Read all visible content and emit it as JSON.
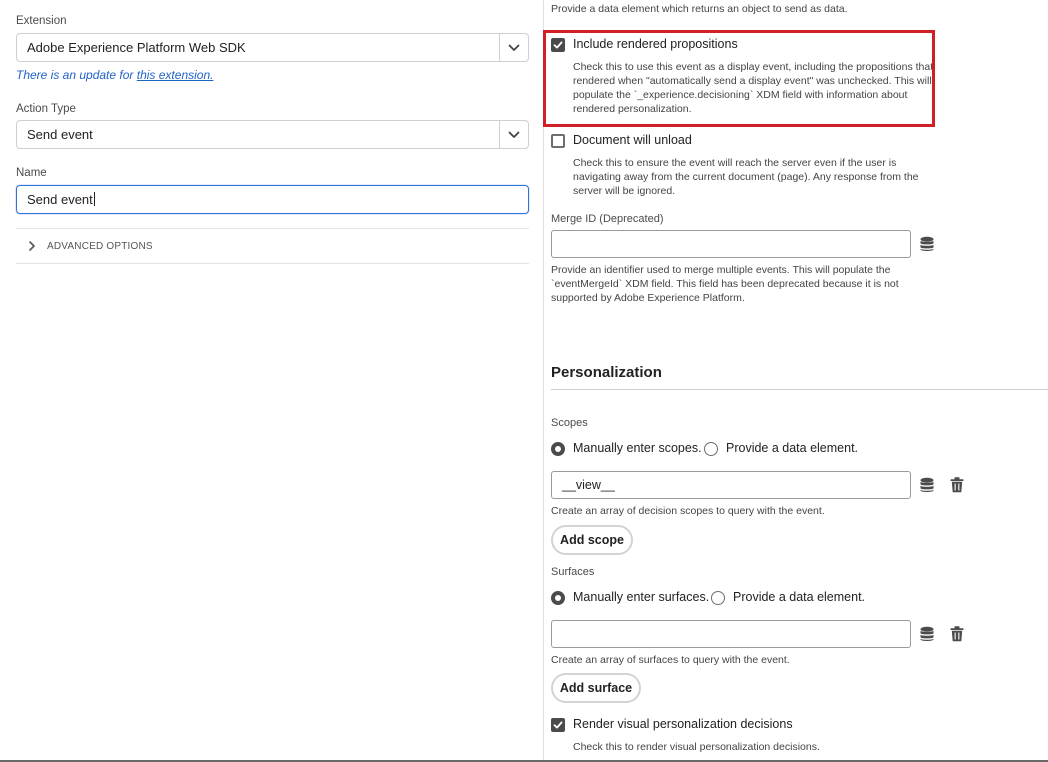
{
  "left": {
    "extension_label": "Extension",
    "extension_value": "Adobe Experience Platform Web SDK",
    "update_prefix": "There is an update for ",
    "update_link": "this extension.",
    "action_type_label": "Action Type",
    "action_type_value": "Send event",
    "name_label": "Name",
    "name_value": "Send event",
    "advanced_options": "ADVANCED OPTIONS"
  },
  "right": {
    "top_help": "Provide a data element which returns an object to send as data.",
    "include_props": {
      "label": "Include rendered propositions",
      "checked": true,
      "help": [
        "Check this to use this event as a display event, including the propositions that",
        "rendered when \"automatically send a display event\" was unchecked. This will",
        "populate the `_experience.decisioning` XDM field with information about",
        "rendered personalization."
      ]
    },
    "doc_unload": {
      "label": "Document will unload",
      "checked": false,
      "help": [
        "Check this to ensure the event will reach the server even if the user is",
        "navigating away from the current document (page). Any response from the",
        "server will be ignored."
      ]
    },
    "merge_id": {
      "label": "Merge ID (Deprecated)",
      "value": "",
      "help": [
        "Provide an identifier used to merge multiple events. This will populate the",
        "`eventMergeId` XDM field. This field has been deprecated because it is not",
        "supported by Adobe Experience Platform."
      ]
    },
    "personalization": {
      "title": "Personalization",
      "scopes_label": "Scopes",
      "scopes_manual": "Manually enter scopes.",
      "scopes_data": "Provide a data element.",
      "scope_value": "__view__",
      "scopes_help": "Create an array of decision scopes to query with the event.",
      "add_scope": "Add scope",
      "surfaces_label": "Surfaces",
      "surfaces_manual": "Manually enter surfaces.",
      "surfaces_data": "Provide a data element.",
      "surface_value": "",
      "surfaces_help": "Create an array of surfaces to query with the event.",
      "add_surface": "Add surface",
      "render_label": "Render visual personalization decisions",
      "render_checked": true,
      "render_help": "Check this to render visual personalization decisions."
    }
  },
  "colors": {
    "highlight": "#d11f26",
    "link": "#2064c6",
    "focus": "#2f73d9"
  },
  "icons": [
    "chevron-down-icon",
    "chevron-right-icon",
    "checkmark-icon",
    "database-icon",
    "trash-icon"
  ]
}
